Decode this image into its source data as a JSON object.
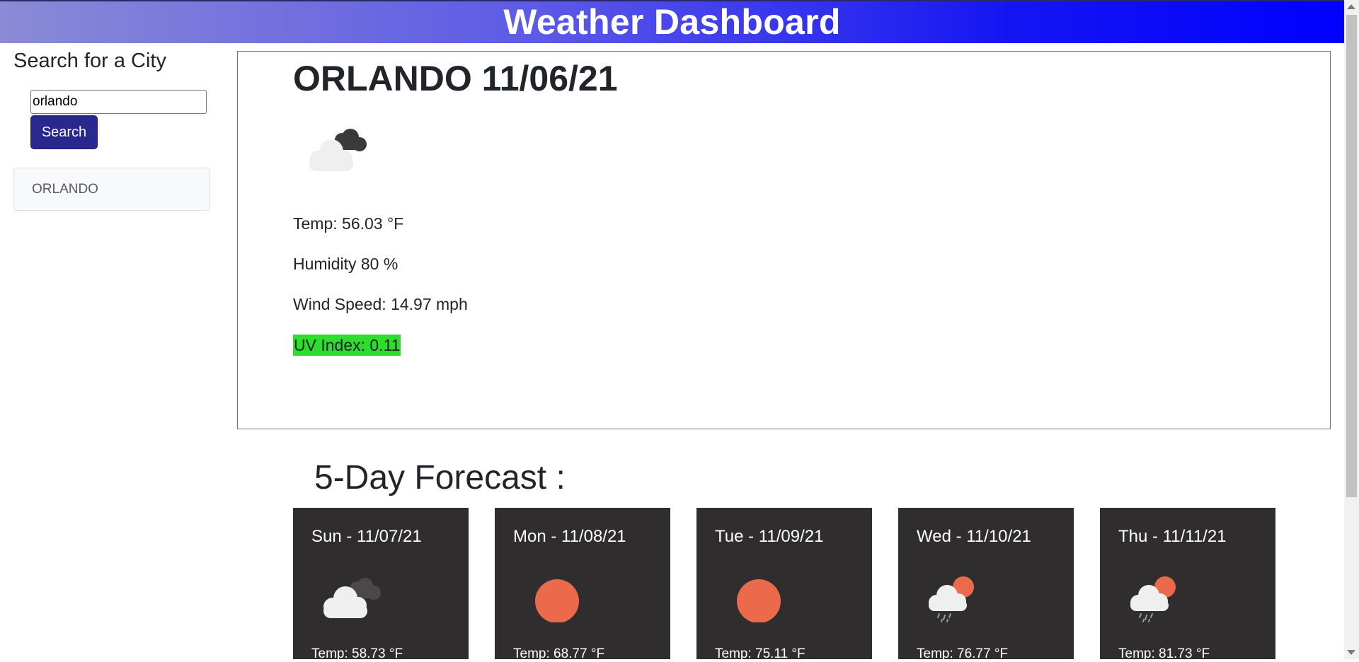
{
  "header": {
    "title": "Weather Dashboard"
  },
  "sidebar": {
    "title": "Search for a City",
    "search_value": "orlando",
    "search_button": "Search",
    "history": [
      "ORLANDO"
    ]
  },
  "current": {
    "title": "ORLANDO 11/06/21",
    "icon": "broken-clouds-icon",
    "temp": "Temp: 56.03 °F",
    "humidity": "Humidity 80 %",
    "wind": "Wind Speed: 14.97 mph",
    "uv": "UV Index: 0.11",
    "uv_color": "#2ddd2d"
  },
  "forecast": {
    "title": "5-Day Forecast :",
    "days": [
      {
        "date": "Sun - 11/07/21",
        "icon": "broken-clouds-icon",
        "temp": "Temp: 58.73 °F"
      },
      {
        "date": "Mon - 11/08/21",
        "icon": "clear-sky-icon",
        "temp": "Temp: 68.77 °F"
      },
      {
        "date": "Tue - 11/09/21",
        "icon": "clear-sky-icon",
        "temp": "Temp: 75.11 °F"
      },
      {
        "date": "Wed - 11/10/21",
        "icon": "rain-sun-icon",
        "temp": "Temp: 76.77 °F"
      },
      {
        "date": "Thu - 11/11/21",
        "icon": "rain-sun-icon",
        "temp": "Temp: 81.73 °F"
      }
    ]
  },
  "colors": {
    "header_gradient_start": "#8a8ad6",
    "header_gradient_end": "#0000ff",
    "search_button": "#29288f",
    "forecast_card": "#2f2d2e",
    "sun": "#ec6a4c"
  }
}
